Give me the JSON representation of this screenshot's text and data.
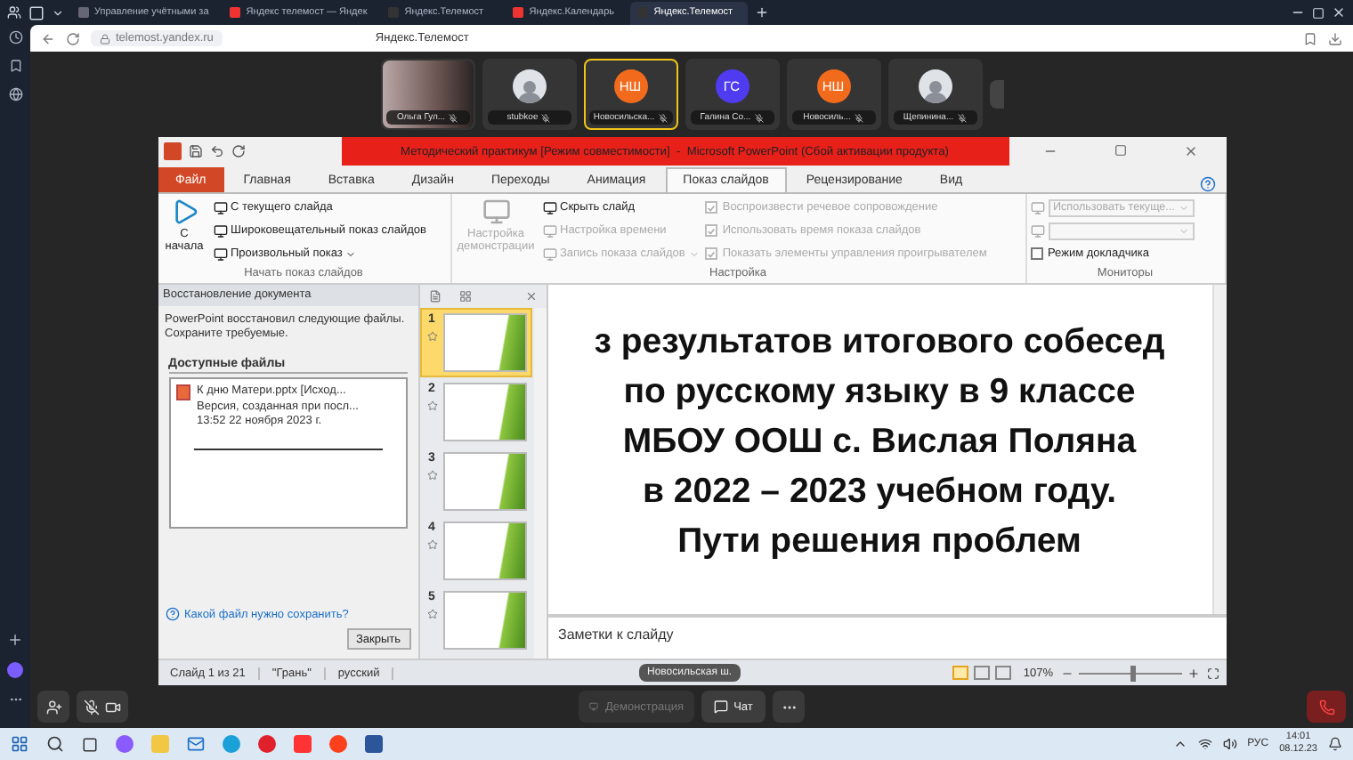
{
  "browser": {
    "tabs": [
      {
        "title": "Управление учётными за",
        "selected": false
      },
      {
        "title": "Яндекс телемост — Яндек",
        "selected": false
      },
      {
        "title": "Яндекс.Телемост",
        "selected": false
      },
      {
        "title": "Яндекс.Календарь",
        "selected": false
      },
      {
        "title": "Яндекс.Телемост",
        "selected": true
      }
    ],
    "url": "telemost.yandex.ru",
    "page_title": "Яндекс.Телемост"
  },
  "participants": [
    {
      "name": "Ольга Гул...",
      "kind": "video",
      "selected": false
    },
    {
      "name": "stubkoe",
      "kind": "photo",
      "selected": false
    },
    {
      "name": "Новосильска...",
      "kind": "initials",
      "initials": "НШ",
      "color": "#f26b1d",
      "selected": true
    },
    {
      "name": "Галина Со...",
      "kind": "initials",
      "initials": "ГС",
      "color": "#4f3cf0",
      "selected": false
    },
    {
      "name": "Новосиль...",
      "kind": "initials",
      "initials": "НШ",
      "color": "#f26b1d",
      "selected": false
    },
    {
      "name": "Щепинина...",
      "kind": "photo",
      "selected": false
    }
  ],
  "powerpoint": {
    "title": "Методический практикум [Режим совместимости]  -  Microsoft PowerPoint (Сбой активации продукта)",
    "tabs": [
      {
        "label": "Файл",
        "kind": "file",
        "selected": false
      },
      {
        "label": "Главная",
        "kind": "tab",
        "selected": false
      },
      {
        "label": "Вставка",
        "kind": "tab",
        "selected": false
      },
      {
        "label": "Дизайн",
        "kind": "tab",
        "selected": false
      },
      {
        "label": "Переходы",
        "kind": "tab",
        "selected": false
      },
      {
        "label": "Анимация",
        "kind": "tab",
        "selected": false
      },
      {
        "label": "Показ слайдов",
        "kind": "tab",
        "selected": true
      },
      {
        "label": "Рецензирование",
        "kind": "tab",
        "selected": false
      },
      {
        "label": "Вид",
        "kind": "tab",
        "selected": false
      }
    ],
    "ribbon": [
      {
        "label": "Начать показ слайдов",
        "big": {
          "label": "С начала",
          "disabled": false
        },
        "items": [
          {
            "label": "С текущего слайда",
            "kind": "command",
            "disabled": false
          },
          {
            "label": "Широковещательный показ слайдов",
            "kind": "command",
            "disabled": false
          },
          {
            "label": "Произвольный показ",
            "kind": "menu",
            "disabled": false
          }
        ]
      },
      {
        "label": "Настройка",
        "big": {
          "label": "Настройка демонстрации",
          "disabled": true
        },
        "items": [
          {
            "label": "Скрыть слайд",
            "kind": "command",
            "disabled": false
          },
          {
            "label": "Настройка времени",
            "kind": "command",
            "disabled": true
          },
          {
            "label": "Запись показа слайдов",
            "kind": "menu",
            "disabled": true
          }
        ],
        "checks": [
          {
            "label": "Воспроизвести речевое сопровождение",
            "checked": true,
            "disabled": true
          },
          {
            "label": "Использовать время показа слайдов",
            "checked": true,
            "disabled": true
          },
          {
            "label": "Показать элементы управления проигрывателем",
            "checked": true,
            "disabled": true
          }
        ]
      },
      {
        "label": "Мониторы",
        "selects": [
          {
            "value": "Использовать текуще...",
            "disabled": true
          },
          {
            "disabled": true
          }
        ],
        "checks": [
          {
            "label": "Режим докладчика",
            "checked": false,
            "disabled": false
          }
        ]
      }
    ],
    "recovery": {
      "title": "Восстановление документа",
      "message": "PowerPoint восстановил следующие файлы. Сохраните требуемые.",
      "heading": "Доступные файлы",
      "file_lines": [
        "К дню Матери.pptx  [Исход...",
        "Версия, созданная при посл...",
        "13:52 22 ноября 2023 г."
      ],
      "help_link": "Какой файл нужно сохранить?",
      "close_button": "Закрыть"
    },
    "thumbnails": [
      {
        "number": "1",
        "selected": true
      },
      {
        "number": "2",
        "selected": false
      },
      {
        "number": "3",
        "selected": false
      },
      {
        "number": "4",
        "selected": false
      },
      {
        "number": "5",
        "selected": false
      }
    ],
    "slide_lines": [
      "з результатов итогового собесед",
      "по русскому языку в 9  классе",
      "МБОУ ООШ с. Вислая Поляна",
      "в 2022 – 2023 учебном году.",
      "Пути решения проблем"
    ],
    "notes_placeholder": "Заметки к слайду",
    "status": {
      "items": [
        "Слайд 1 из 21",
        "\"Грань\"",
        "русский"
      ],
      "zoom": "107%",
      "zoom_slider": {
        "level": 0.5
      }
    },
    "speaker_badge": "Новосильская ш."
  },
  "controls": {
    "demo": {
      "label": "Демонстрация",
      "disabled": true
    },
    "chat": {
      "label": "Чат"
    }
  },
  "taskbar": {
    "language": "РУС",
    "time": "14:01",
    "date": "08.12.23"
  }
}
